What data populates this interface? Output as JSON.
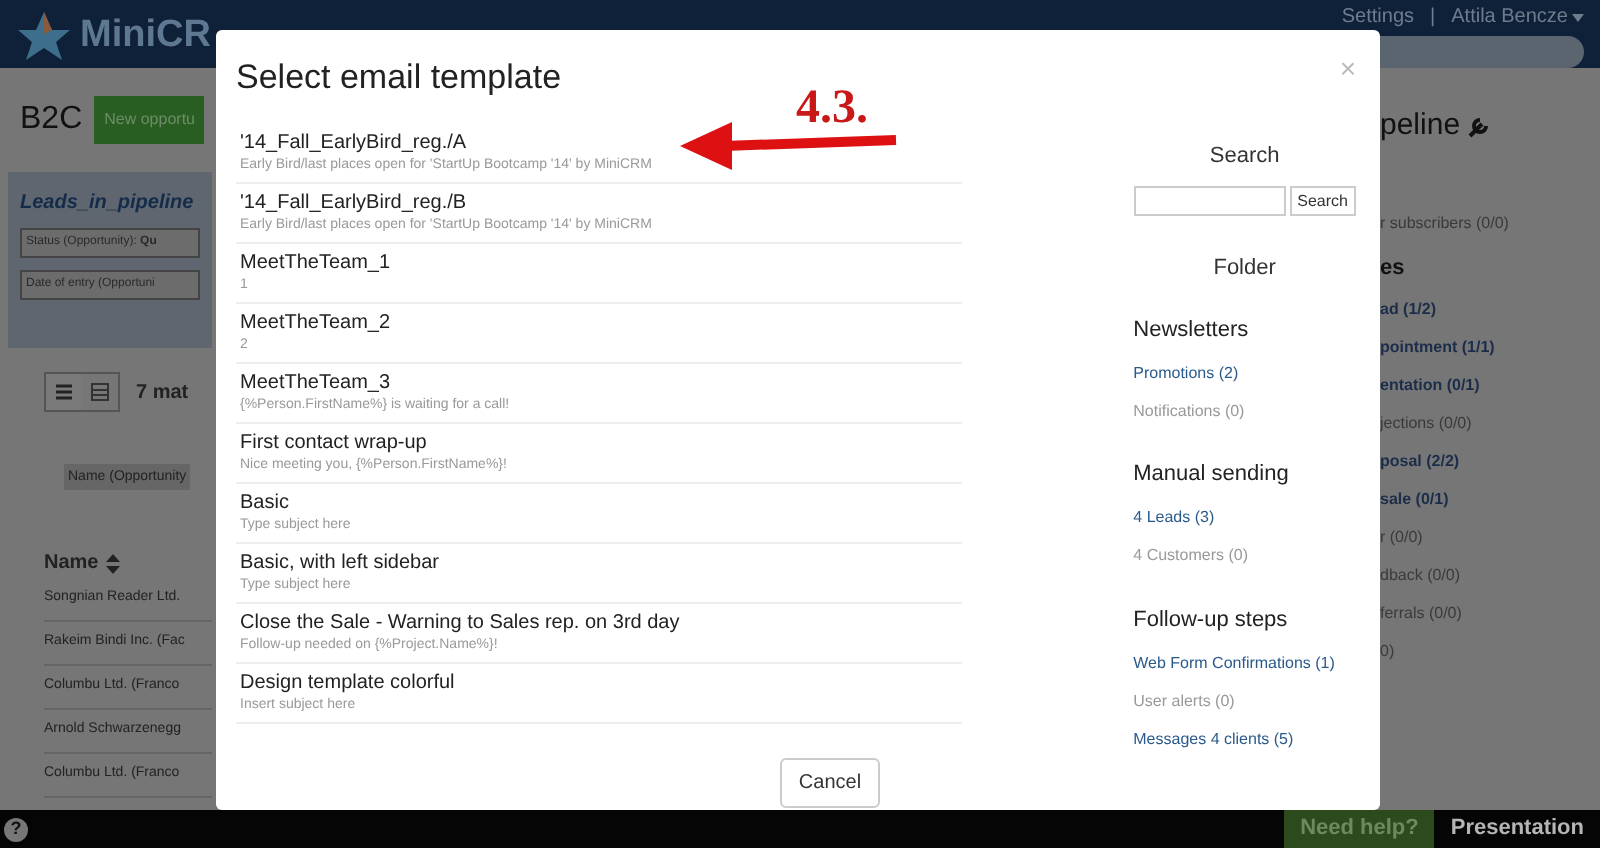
{
  "header": {
    "logo": "MiniCR",
    "settings": "Settings",
    "separator": "|",
    "user": "Attila Bencze"
  },
  "page": {
    "title": "B2C",
    "new_button": "New opportu",
    "panel_title": "Leads_in_pipeline",
    "filters": [
      "Status (Opportunity): **Qu**",
      "Date of entry (Opportuni"
    ],
    "match_count": "7 mat",
    "column_filter": "Name (Opportunity",
    "name_header": "Name",
    "rows": [
      "Songnian Reader Ltd.",
      "Rakeim Bindi Inc. (Fac",
      "Columbu Ltd. (Franco",
      "Arnold Schwarzenegg",
      "Columbu Ltd. (Franco"
    ]
  },
  "right_panel": {
    "heading": "peline",
    "items": [
      {
        "text": "r subscribers (0/0)",
        "kind": "muted"
      },
      {
        "text": "es",
        "kind": "heading"
      },
      {
        "text": "ad (1/2)",
        "kind": "link"
      },
      {
        "text": "pointment (1/1)",
        "kind": "link"
      },
      {
        "text": "entation (0/1)",
        "kind": "link"
      },
      {
        "text": "jections (0/0)",
        "kind": "muted"
      },
      {
        "text": "posal (2/2)",
        "kind": "link"
      },
      {
        "text": "sale (0/1)",
        "kind": "link"
      },
      {
        "text": "r (0/0)",
        "kind": "muted"
      },
      {
        "text": "dback (0/0)",
        "kind": "muted"
      },
      {
        "text": "ferrals (0/0)",
        "kind": "muted"
      },
      {
        "text": "0)",
        "kind": "muted"
      }
    ]
  },
  "modal": {
    "title": "Select email template",
    "close": "×",
    "templates": [
      {
        "name": "'14_Fall_EarlyBird_reg./A",
        "subject": "Early Bird/last places open for 'StartUp Bootcamp '14' by MiniCRM"
      },
      {
        "name": "'14_Fall_EarlyBird_reg./B",
        "subject": "Early Bird/last places open for 'StartUp Bootcamp '14' by MiniCRM"
      },
      {
        "name": "MeetTheTeam_1",
        "subject": "1"
      },
      {
        "name": "MeetTheTeam_2",
        "subject": "2"
      },
      {
        "name": "MeetTheTeam_3",
        "subject": "{%Person.FirstName%} is waiting for a call!"
      },
      {
        "name": "First contact wrap-up",
        "subject": "Nice meeting you, {%Person.FirstName%}!"
      },
      {
        "name": "Basic",
        "subject": "Type subject here"
      },
      {
        "name": "Basic, with left sidebar",
        "subject": "Type subject here"
      },
      {
        "name": "Close the Sale - Warning to Sales rep. on 3rd day",
        "subject": "Follow-up needed on {%Project.Name%}!"
      },
      {
        "name": "Design template colorful",
        "subject": "Insert subject here"
      }
    ],
    "search_heading": "Search",
    "search_button": "Search",
    "folder_heading": "Folder",
    "groups": [
      {
        "title": "Newsletters",
        "items": [
          {
            "label": "Promotions (2)",
            "empty": false
          },
          {
            "label": "Notifications (0)",
            "empty": true
          }
        ]
      },
      {
        "title": "Manual sending",
        "items": [
          {
            "label": "4 Leads (3)",
            "empty": false
          },
          {
            "label": "4 Customers (0)",
            "empty": true
          }
        ]
      },
      {
        "title": "Follow-up steps",
        "items": [
          {
            "label": "Web Form Confirmations (1)",
            "empty": false
          },
          {
            "label": "User alerts (0)",
            "empty": true
          },
          {
            "label": "Messages 4 clients (5)",
            "empty": false
          }
        ]
      }
    ],
    "cancel": "Cancel"
  },
  "annotation": "4.3.",
  "bottom_bar": {
    "help": "?",
    "need_help": "Need help?",
    "presentation": "Presentation"
  }
}
